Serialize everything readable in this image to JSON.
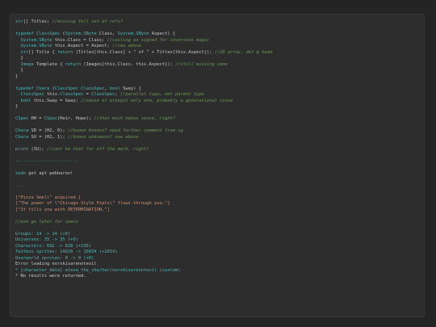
{
  "lines": [
    [
      "str[] Titles; ",
      "//missing full set of refs?"
    ],
    [
      ""
    ],
    [
      "typedef ClassSpec (System.SByte Class, System.SByte Aspect) {"
    ],
    [
      "  System.SByte this.Class = Class; ",
      "//casting as signed for inversion magic"
    ],
    [
      "  System.SByte this.Aspect = Aspect; ",
      "//see above"
    ],
    [
      "  str[] Title { return (Titles[this.Class] + \" of \" + Titles[this.Aspect]); ",
      "//2D array, def @ head"
    ],
    [
      "  }"
    ],
    [
      "  Image Template { return (Images[this.Class, this.Aspect]); ",
      "//still missing some"
    ],
    [
      "  }"
    ],
    [
      "}"
    ],
    [
      ""
    ],
    [
      "typedef Chara (ClassSpec ClassSpec, bool Sway) {"
    ],
    [
      "  ClassSpec this.ClassSpec = ClassSpec; ",
      "//parallel type, not parent type"
    ],
    [
      "  bool this.Sway = Sway; ",
      "//sense or prospit only atm, probably a generational issue"
    ],
    [
      "}"
    ],
    [
      ""
    ],
    [
      "CSpec HH = CSpec(Heir, Hope); ",
      "//that much makes sense, right?"
    ],
    [
      ""
    ],
    [
      "Chara SD = (H2, 0); ",
      "//known knowns? need further comment from cg"
    ],
    [
      "Chara SU = (H2, 1); ",
      "//known unknowns? see above"
    ],
    [
      ""
    ],
    [
      "print (SU); ",
      "//cant be that far off the mark, right?"
    ],
    [
      ""
    ],
    [
      "------------------------"
    ],
    [
      ""
    ],
    [
      "sudo get apt pebbaron!"
    ],
    [
      ""
    ],
    [
      "..."
    ],
    [
      ""
    ],
    [
      "[\"Pizza Smell\" acquired.]"
    ],
    [
      "[\"The power of \\\"Chicago Style Pipts\\\" flows through you.\"]"
    ],
    [
      "[\"It fills you with DETERMINATION.\"]"
    ],
    [
      ""
    ],
    [
      "//ask ge later for specs"
    ],
    [
      ""
    ],
    [
      "Groups: 14 -> 14 (+0)"
    ],
    [
      "Universes: 35 -> 35 (+0)"
    ],
    [
      "Characters: 692 -> 828 (+136)"
    ],
    [
      "Textbox sprites: 14820 -> 16834 (+2014)"
    ],
    [
      "Overworld sprites: 0 -> 0 (+0)"
    ],
    [
      "Error loading norskisarenotevil"
    ],
    [
      "* [character_data] alexa_the_she/her/norskisarenotevil (custom)"
    ],
    [
      "* No results were returned."
    ]
  ],
  "colors": {
    "background": "#242424",
    "panel": "#2d2d2d",
    "keyword": "#4fb8b8",
    "comment": "#6a9955",
    "string": "#ce9178",
    "text": "#c8c8c8"
  }
}
